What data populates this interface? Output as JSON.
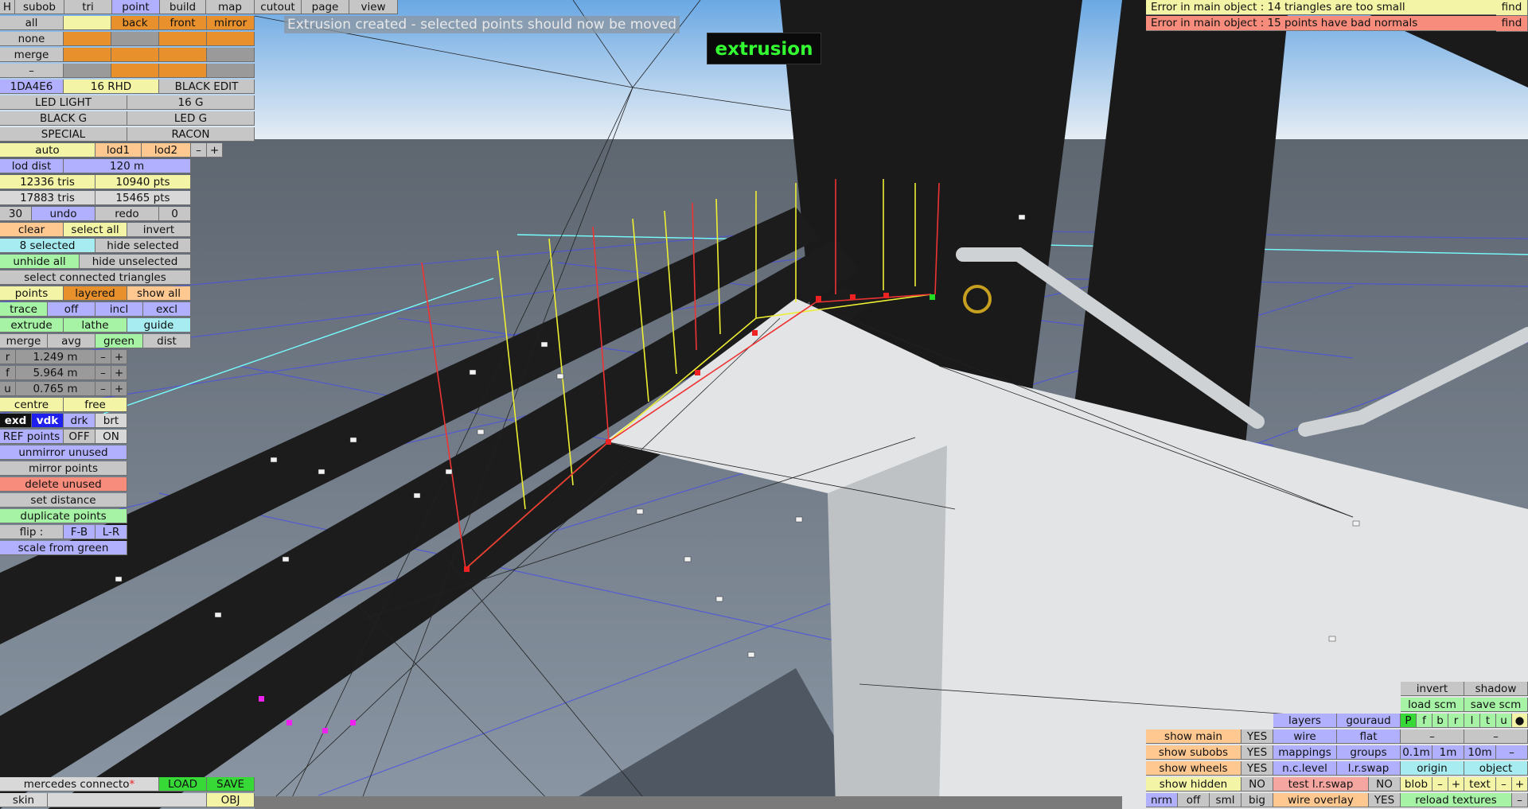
{
  "mode_label": "extrusion",
  "status_message": "Extrusion created - selected points should now be moved",
  "errors": [
    {
      "text": "Error in main object : 14 triangles are too small",
      "find": "find"
    },
    {
      "text": "Error in main object : 15 points have bad normals",
      "find": "find"
    }
  ],
  "tabs": {
    "h": "H",
    "subob": "subob",
    "tri": "tri",
    "point": "point",
    "build": "build",
    "map": "map",
    "cutout": "cutout",
    "page": "page",
    "view": "view"
  },
  "sel": {
    "all": "all",
    "back": "back",
    "front": "front",
    "mirror": "mirror",
    "none": "none",
    "merge": "merge",
    "minus": "–"
  },
  "mat": {
    "code": "1DA4E6",
    "rhd": "16 RHD",
    "black_edit": "BLACK EDIT",
    "led_light": "LED LIGHT",
    "g16": "16 G",
    "black_g": "BLACK G",
    "led_g": "LED G",
    "special": "SPECIAL",
    "racon": "RACON"
  },
  "lod": {
    "auto": "auto",
    "lod1": "lod1",
    "lod2": "lod2",
    "minus": "–",
    "plus": "+",
    "dist_label": "lod dist",
    "dist_value": "120 m"
  },
  "stats": {
    "tris1": "12336 tris",
    "pts1": "10940 pts",
    "tris2": "17883 tris",
    "pts2": "15465 pts"
  },
  "undo": {
    "count": "30",
    "undo": "undo",
    "redo": "redo",
    "zero": "0"
  },
  "selection": {
    "clear": "clear",
    "select_all": "select all",
    "invert": "invert",
    "selected": "8 selected",
    "hide_selected": "hide selected",
    "unhide_all": "unhide all",
    "hide_unselected": "hide unselected",
    "select_connected": "select connected triangles",
    "points": "points",
    "layered": "layered",
    "show_all": "show all"
  },
  "trace": {
    "trace": "trace",
    "off": "off",
    "incl": "incl",
    "excl": "excl"
  },
  "ops": {
    "extrude": "extrude",
    "lathe": "lathe",
    "guide": "guide",
    "merge": "merge",
    "avg": "avg",
    "green": "green",
    "dist": "dist"
  },
  "rfu": [
    {
      "key": "r",
      "value": "1.249 m"
    },
    {
      "key": "f",
      "value": "5.964 m"
    },
    {
      "key": "u",
      "value": "0.765 m"
    }
  ],
  "pm": {
    "minus": "–",
    "plus": "+"
  },
  "centre": {
    "centre": "centre",
    "free": "free"
  },
  "view_modes": {
    "exd": "exd",
    "vdk": "vdk",
    "drk": "drk",
    "brt": "brt"
  },
  "ref": {
    "label": "REF points",
    "off": "OFF",
    "on": "ON"
  },
  "actions": {
    "unmirror": "unmirror unused",
    "mirror_points": "mirror points",
    "delete_unused": "delete unused",
    "set_distance": "set distance",
    "duplicate": "duplicate points",
    "flip": "flip :",
    "fb": "F-B",
    "lr": "L-R",
    "scale": "scale from green"
  },
  "file": {
    "name": "mercedes connecto",
    "load": "LOAD",
    "save": "SAVE",
    "skin": "skin",
    "obj": "OBJ"
  },
  "br": {
    "invert": "invert",
    "shadow": "shadow",
    "load_scm": "load scm",
    "save_scm": "save scm",
    "layers": "layers",
    "gouraud": "gouraud",
    "flags": [
      "P",
      "f",
      "b",
      "r",
      "l",
      "t",
      "u"
    ],
    "dot": "●",
    "show_main": "show main",
    "yes": "YES",
    "wire": "wire",
    "flat": "flat",
    "dash": "–",
    "show_subobs": "show subobs",
    "mappings": "mappings",
    "groups": "groups",
    "d01": "0.1m",
    "d1": "1m",
    "d10": "10m",
    "show_wheels": "show wheels",
    "nclevel": "n.c.level",
    "lrswap": "l.r.swap",
    "origin": "origin",
    "object": "object",
    "show_hidden": "show hidden",
    "no": "NO",
    "test_lrswap": "test l.r.swap",
    "blob": "blob",
    "minus": "–",
    "plus": "+",
    "text": "text",
    "nrm": "nrm",
    "off": "off",
    "sml": "sml",
    "big": "big",
    "wire_overlay": "wire overlay",
    "reload": "reload textures"
  }
}
